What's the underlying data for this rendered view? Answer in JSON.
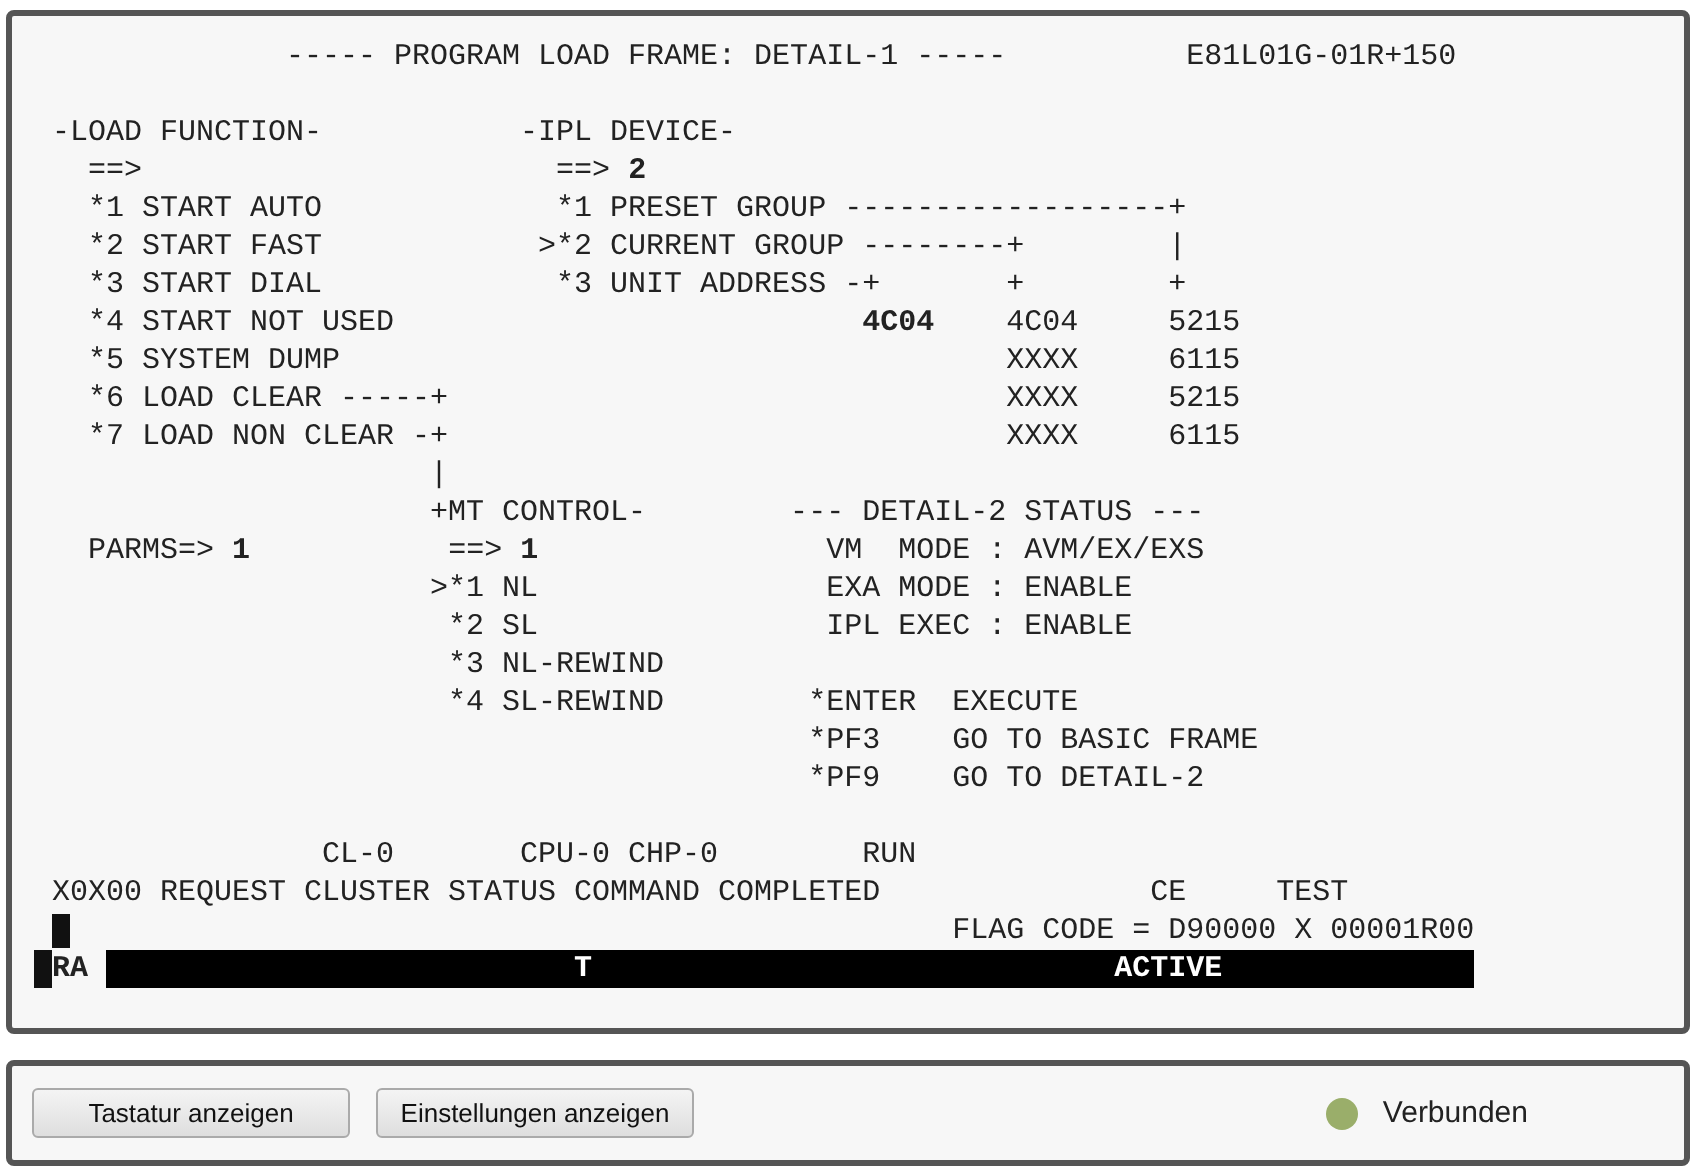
{
  "terminal": {
    "lines": [
      {
        "kind": "text",
        "text": "              ----- PROGRAM LOAD FRAME: DETAIL-1 -----          E81L01G-01R+150"
      },
      {
        "kind": "blank"
      },
      {
        "kind": "text",
        "text": " -LOAD FUNCTION-           -IPL DEVICE-"
      },
      {
        "kind": "text",
        "text": "   ==>                       ==> **2**"
      },
      {
        "kind": "text",
        "text": "   *1 START AUTO             *1 PRESET GROUP ------------------+"
      },
      {
        "kind": "text",
        "text": "   *2 START FAST            >*2 CURRENT GROUP --------+        |"
      },
      {
        "kind": "text",
        "text": "   *3 START DIAL             *3 UNIT ADDRESS -+       +        +"
      },
      {
        "kind": "text",
        "text": "   *4 START NOT USED                          **4C04**    4C04     5215"
      },
      {
        "kind": "text",
        "text": "   *5 SYSTEM DUMP                                     XXXX     6115"
      },
      {
        "kind": "text",
        "text": "   *6 LOAD CLEAR -----+                               XXXX     5215"
      },
      {
        "kind": "text",
        "text": "   *7 LOAD NON CLEAR -+                               XXXX     6115"
      },
      {
        "kind": "text",
        "text": "                      |"
      },
      {
        "kind": "text",
        "text": "                      +MT CONTROL-        --- DETAIL-2 STATUS ---"
      },
      {
        "kind": "text",
        "text": "   PARMS=> **1**           ==> **1**                VM  MODE : AVM/EX/EXS"
      },
      {
        "kind": "text",
        "text": "                      >*1 NL                EXA MODE : ENABLE"
      },
      {
        "kind": "text",
        "text": "                       *2 SL                IPL EXEC : ENABLE"
      },
      {
        "kind": "text",
        "text": "                       *3 NL-REWIND"
      },
      {
        "kind": "text",
        "text": "                       *4 SL-REWIND        *ENTER  EXECUTE"
      },
      {
        "kind": "text",
        "text": "                                           *PF3    GO TO BASIC FRAME"
      },
      {
        "kind": "text",
        "text": "                                           *PF9    GO TO DETAIL-2"
      },
      {
        "kind": "blank"
      },
      {
        "kind": "text",
        "text": "                CL-0       CPU-0 CHP-0        RUN"
      },
      {
        "kind": "text",
        "text": " X0X00 REQUEST CLUSTER STATUS COMMAND COMPLETED               CE     TEST"
      },
      {
        "kind": "text",
        "cursor": true,
        "text": "                                                   FLAG CODE = D90000 X 00001R00"
      }
    ],
    "status_line": {
      "indicator": "RA",
      "text": "                          T                             ACTIVE"
    }
  },
  "footer": {
    "buttons": [
      "Tastatur anzeigen",
      "Einstellungen anzeigen"
    ],
    "connection": {
      "label": "Verbunden",
      "color": "#9aae6a"
    }
  }
}
